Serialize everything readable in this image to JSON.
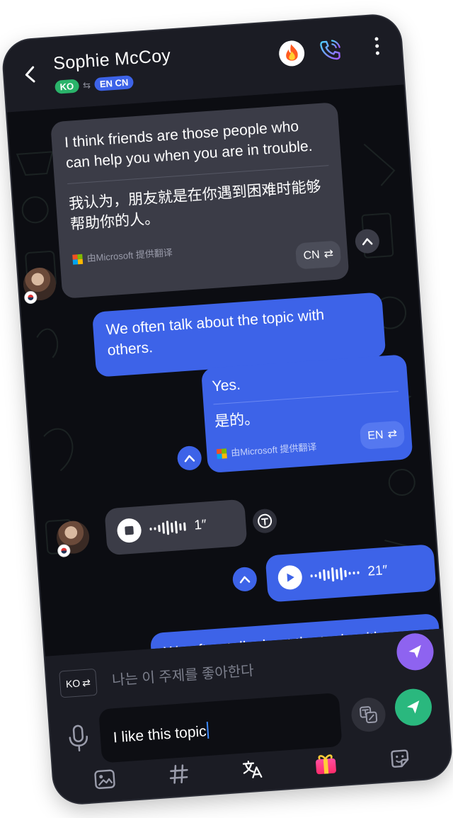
{
  "header": {
    "contact_name": "Sophie McCoy",
    "source_lang": "KO",
    "target_langs": "EN CN",
    "icons": [
      "back-arrow-icon",
      "fire-icon",
      "phone-call-icon",
      "more-vertical-icon"
    ]
  },
  "messages": [
    {
      "direction": "incoming",
      "text": "I think friends are those people who can help you when you are in trouble.",
      "translation": "我认为，朋友就是在你遇到困难时能够帮助你的人。",
      "provider": "由Microsoft 提供翻译",
      "lang_tag": "CN"
    },
    {
      "direction": "outgoing",
      "text": "We often talk about the topic with others."
    },
    {
      "direction": "outgoing",
      "text": "Yes.",
      "translation": "是的。",
      "provider": "由Microsoft 提供翻译",
      "lang_tag": "EN"
    },
    {
      "direction": "incoming",
      "type": "voice",
      "duration": "1″"
    },
    {
      "direction": "outgoing",
      "type": "voice",
      "duration": "21″"
    },
    {
      "direction": "outgoing",
      "text": "We often talk about the topic with others."
    }
  ],
  "composer": {
    "lang_button": "KO",
    "translation_hint": "나는 이 주제를 좋아한다",
    "input_value": "I like this topic"
  },
  "toolbar": [
    "image-icon",
    "hashtag-icon",
    "translate-icon",
    "gift-icon",
    "sticker-icon"
  ],
  "colors": {
    "accent_blue": "#3d63e8",
    "incoming_bubble": "#3b3c47",
    "send_green": "#2ab87e",
    "send_purple": "#8e63f0",
    "ko_green": "#2ab36a"
  }
}
